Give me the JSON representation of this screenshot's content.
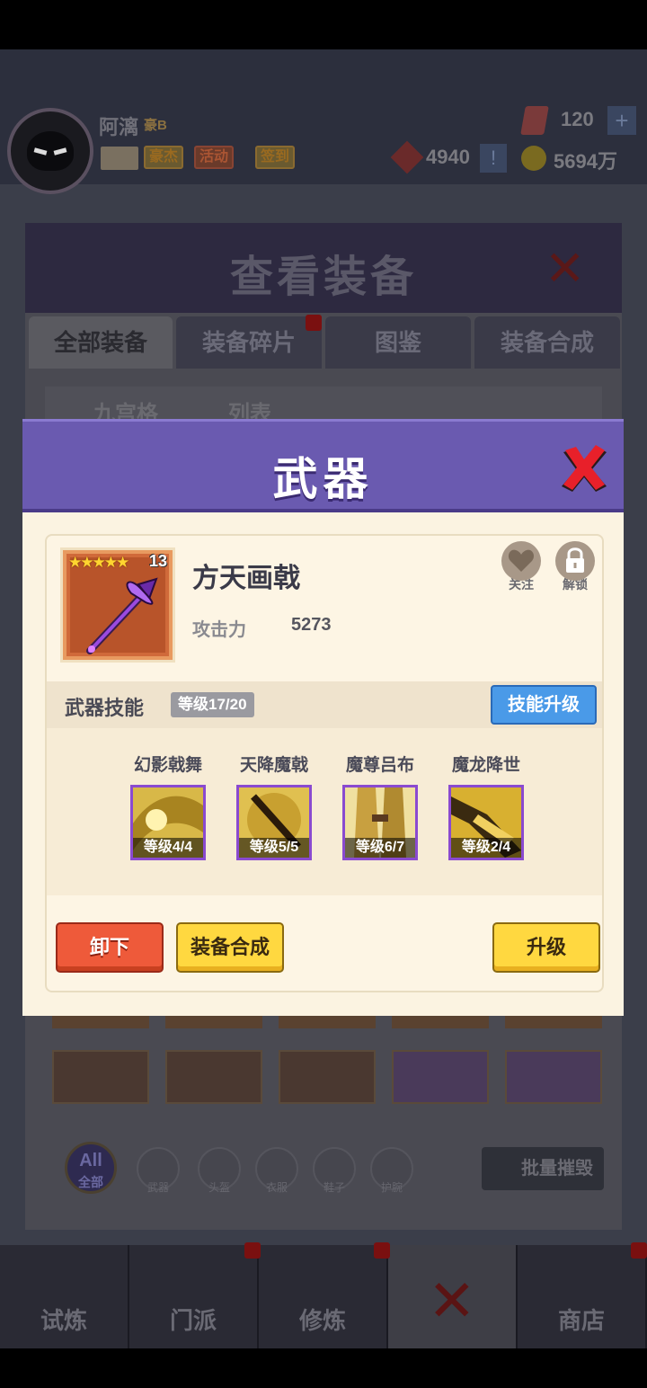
{
  "background": {
    "player": {
      "name": "阿漓",
      "rank": "豪B"
    },
    "top_buttons": [
      "豪杰",
      "活动",
      "签到"
    ],
    "resources": {
      "gems": "120",
      "honor": "4940",
      "coins": "5694万"
    },
    "panel_title": "查看装备",
    "tabs": [
      "全部装备",
      "装备碎片",
      "图鉴",
      "装备合成"
    ],
    "view_modes": [
      "九宫格",
      "列表"
    ],
    "filters": [
      "武器",
      "头盔",
      "衣服",
      "鞋子",
      "护腕"
    ],
    "filter_all": {
      "top": "All",
      "bottom": "全部"
    },
    "destroy_label": "批量摧毁",
    "nav": [
      "试炼",
      "门派",
      "修炼",
      "",
      "商店"
    ]
  },
  "modal": {
    "title": "武器",
    "item": {
      "name": "方天画戟",
      "stars": "★★★★★",
      "level": "13",
      "stat_label": "攻击力",
      "stat_value": "5273"
    },
    "corner_buttons": {
      "follow": "关注",
      "unlock": "解锁"
    },
    "skill_section": {
      "title": "武器技能",
      "level_tag": "等级17/20",
      "upgrade_button": "技能升级"
    },
    "skills": [
      {
        "name": "幻影戟舞",
        "level": "等级4/4"
      },
      {
        "name": "天降魔戟",
        "level": "等级5/5"
      },
      {
        "name": "魔尊吕布",
        "level": "等级6/7"
      },
      {
        "name": "魔龙降世",
        "level": "等级2/4"
      }
    ],
    "buttons": {
      "unequip": "卸下",
      "synthesize": "装备合成",
      "upgrade": "升级"
    }
  },
  "colors": {
    "header_purple": "#6a5ab0",
    "skill_border": "#8a4ad0",
    "upgrade_blue": "#4a9ae8",
    "unequip_red": "#ee5a3a",
    "yellow": "#ffd840"
  }
}
